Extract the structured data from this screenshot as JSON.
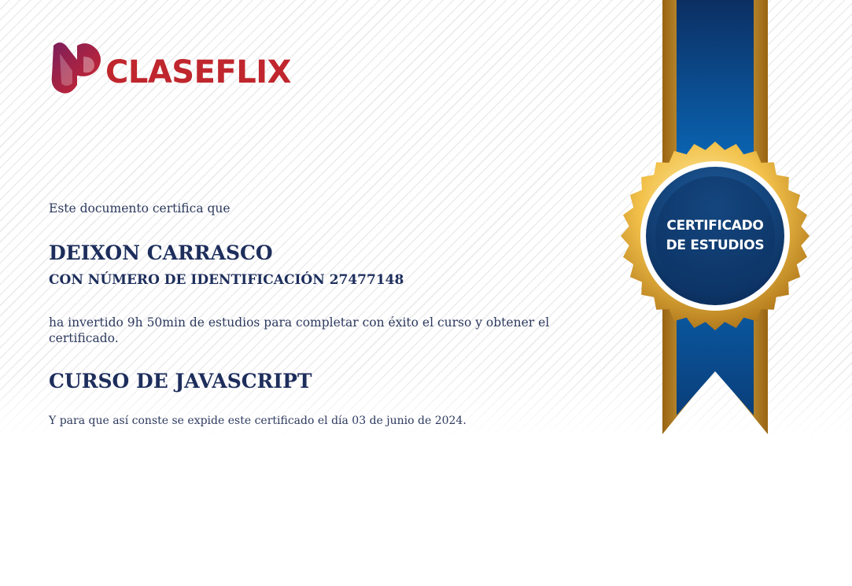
{
  "brand": {
    "logo_text_light": "CLASE",
    "logo_text_bold": "FLIX"
  },
  "certificate": {
    "intro": "Este documento certifica que",
    "recipient_name": "DEIXON CARRASCO",
    "id_line": "CON NÚMERO DE IDENTIFICACIÓN 27477148",
    "invested_text": "ha invertido 9h 50min de estudios para completar con éxito el curso y obtener el certificado.",
    "course_title": "CURSO DE JAVASCRIPT",
    "issued_text": "Y para que así conste se expide este certificado el día 03 de junio de 2024."
  },
  "seal": {
    "line1": "CERTIFICADO",
    "line2": "DE ESTUDIOS"
  },
  "colors": {
    "brand_red": "#c0262d",
    "navy_text": "#1d2e5c",
    "ribbon_blue": "#0a5ea8",
    "ribbon_gold": "#c9901f"
  }
}
